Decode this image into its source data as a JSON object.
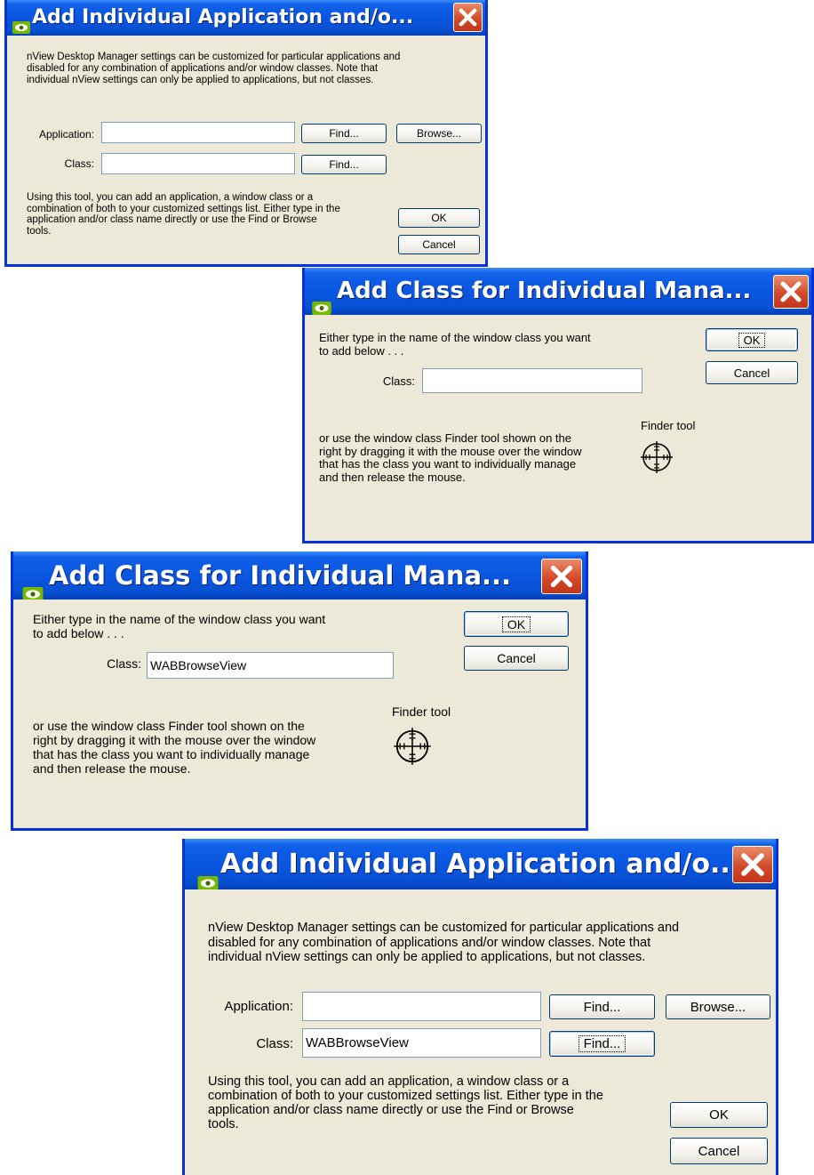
{
  "dialog_add_app_small": {
    "title": "Add Individual Application and/o...",
    "description": [
      "nView Desktop Manager settings can be customized for particular applications and",
      "disabled for any combination of applications and/or window classes. Note that",
      "individual nView settings can only be applied to applications, but not classes."
    ],
    "application_label": "Application:",
    "application_value": "",
    "class_label": "Class:",
    "class_value": "",
    "find_label": "Find...",
    "browse_label": "Browse...",
    "help": [
      "Using this tool, you can add an application, a window class or a",
      "combination of both to your customized settings list. Either type in the",
      "application and/or class name directly or use the Find or Browse",
      "tools."
    ],
    "ok_label": "OK",
    "cancel_label": "Cancel"
  },
  "dialog_add_class_empty": {
    "title": "Add Class for Individual Mana...",
    "intro": [
      "Either type in the name of the window class you want",
      "to add below . . ."
    ],
    "class_label": "Class:",
    "class_value": "",
    "finder_label": "Finder tool",
    "finder_text": [
      "or use the window class Finder tool shown on the",
      "right by dragging it with the mouse over the window",
      "that has the class you want to individually manage",
      "and then release the mouse."
    ],
    "ok_label": "OK",
    "cancel_label": "Cancel"
  },
  "dialog_add_class_filled": {
    "title": "Add Class for Individual Mana...",
    "intro": [
      "Either type in the name of the window class you want",
      "to add below . . ."
    ],
    "class_label": "Class:",
    "class_value": "WABBrowseView",
    "finder_label": "Finder tool",
    "finder_text": [
      "or use the window class Finder tool shown on the",
      "right by dragging it with the mouse over the window",
      "that has the class you want to individually manage",
      "and then release the mouse."
    ],
    "ok_label": "OK",
    "cancel_label": "Cancel"
  },
  "dialog_add_app_large": {
    "title": "Add Individual Application and/o...",
    "description": [
      "nView Desktop Manager settings can be customized for particular applications and",
      "disabled for any combination of applications and/or window classes. Note that",
      "individual nView settings can only be applied to applications, but not classes."
    ],
    "application_label": "Application:",
    "application_value": "",
    "class_label": "Class:",
    "class_value": "WABBrowseView",
    "find_label": "Find...",
    "browse_label": "Browse...",
    "help": [
      "Using this tool, you can add an application, a window class or a",
      "combination of both to your customized settings list. Either type in the",
      "application and/or class name directly or use the Find or Browse",
      "tools."
    ],
    "ok_label": "OK",
    "cancel_label": "Cancel"
  },
  "colors": {
    "titlebar": "#0a56e0",
    "face": "#ece9d8",
    "close": "#d24a2a",
    "button_border": "#003c74"
  },
  "icons": {
    "title": "nvidia-eye-icon",
    "close": "close-x-icon",
    "finder": "crosshair-finder-icon"
  }
}
